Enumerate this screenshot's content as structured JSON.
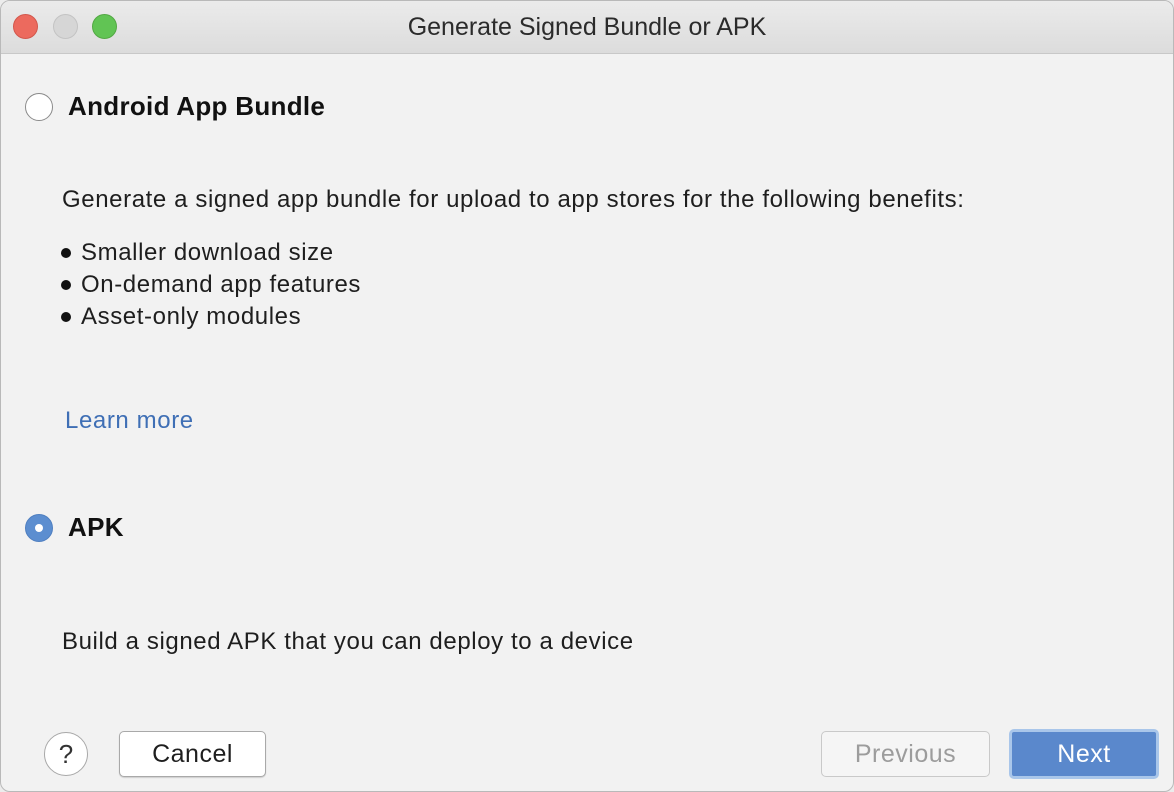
{
  "window": {
    "title": "Generate Signed Bundle or APK"
  },
  "options": {
    "bundle": {
      "label": "Android App Bundle",
      "selected": false,
      "description": "Generate a signed app bundle for upload to app stores for the following benefits:",
      "benefits": [
        "Smaller download size",
        "On-demand app features",
        "Asset-only modules"
      ],
      "learn_more": "Learn more"
    },
    "apk": {
      "label": "APK",
      "selected": true,
      "description": "Build a signed APK that you can deploy to a device"
    }
  },
  "footer": {
    "help_label": "?",
    "cancel_label": "Cancel",
    "previous_label": "Previous",
    "next_label": "Next"
  },
  "colors": {
    "accent": "#5a88cc",
    "link": "#3f6fb5"
  }
}
